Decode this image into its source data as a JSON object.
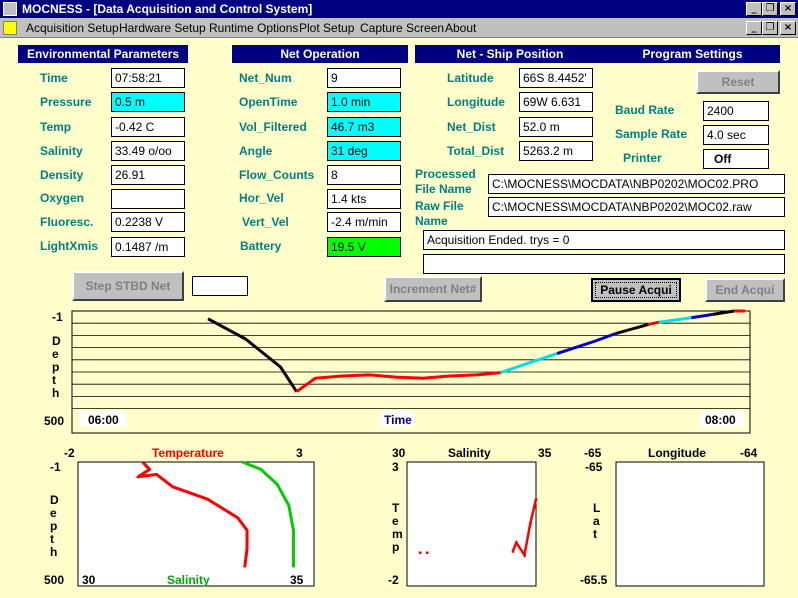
{
  "window": {
    "title": "MOCNESS - [Data Acquisition and Control System]"
  },
  "menu": [
    "Acquisition Setup",
    "Hardware Setup",
    "Runtime Options",
    "Plot Setup",
    "Capture Screen",
    "About"
  ],
  "headers": {
    "env": "Environmental Parameters",
    "net": "Net Operation",
    "pos": "Net - Ship Position",
    "prog": "Program Settings"
  },
  "env": {
    "time_label": "Time",
    "time": "07:58:21",
    "pressure_label": "Pressure",
    "pressure": "0.5 m",
    "temp_label": "Temp",
    "temp": "-0.42 C",
    "salinity_label": "Salinity",
    "salinity": "33.49 o/oo",
    "density_label": "Density",
    "density": "26.91",
    "oxygen_label": "Oxygen",
    "oxygen": "",
    "fluoresc_label": "Fluoresc.",
    "fluoresc": "0.2238 V",
    "lightxmis_label": "LightXmis",
    "lightxmis": "0.1487 /m"
  },
  "net": {
    "net_num_label": "Net_Num",
    "net_num": "9",
    "opentime_label": "OpenTime",
    "opentime": "1.0 min",
    "vol_label": "Vol_Filtered",
    "vol": "46.7 m3",
    "angle_label": "Angle",
    "angle": "31 deg",
    "flow_label": "Flow_Counts",
    "flow": "8",
    "horvel_label": "Hor_Vel",
    "horvel": "1.4 kts",
    "vertvel_label": "Vert_Vel",
    "vertvel": "-2.4 m/min",
    "battery_label": "Battery",
    "battery": "19.5 V"
  },
  "pos": {
    "lat_label": "Latitude",
    "lat": "66S 8.4452'",
    "lon_label": "Longitude",
    "lon": "69W 6.631",
    "netdist_label": "Net_Dist",
    "netdist": "52.0 m",
    "totaldist_label": "Total_Dist",
    "totaldist": "5263.2 m",
    "processed_label_1": "Processed",
    "processed_label_2": "File Name",
    "processed": "C:\\MOCNESS\\MOCDATA\\NBP0202\\MOC02.PRO",
    "raw_label_1": "Raw File",
    "raw_label_2": "Name",
    "raw": "C:\\MOCNESS\\MOCDATA\\NBP0202\\MOC02.raw",
    "status": "Acquisition Ended. trys = 0",
    "status2": ""
  },
  "prog": {
    "reset": "Reset",
    "baud_label": "Baud Rate",
    "baud": "2400",
    "sample_label": "Sample Rate",
    "sample": "4.0 sec",
    "printer_label": "Printer",
    "printer": "Off"
  },
  "buttons": {
    "step": "Step STBD Net",
    "step_field": "",
    "increment": "Increment Net#",
    "pause": "Pause Acqui",
    "end": "End Acqui"
  },
  "colors": {
    "temperature": "#ff0000",
    "salinity": "#00cc00",
    "ctext": "#008080",
    "header": "#000080"
  },
  "chart_data": [
    {
      "type": "line",
      "name": "depth-time",
      "ylabel": "Depth",
      "xlabel": "Time",
      "y_top_label": "-1",
      "y_bottom_label": "500",
      "x_left_label": "06:00",
      "x_right_label": "08:00",
      "segments": [
        {
          "color": "#000000",
          "points": [
            [
              0.0,
              0.07
            ],
            [
              0.07,
              0.25
            ],
            [
              0.135,
              0.5
            ],
            [
              0.165,
              0.72
            ]
          ]
        },
        {
          "color": "#ff0000",
          "points": [
            [
              0.165,
              0.72
            ],
            [
              0.2,
              0.6
            ],
            [
              0.25,
              0.58
            ],
            [
              0.3,
              0.57
            ],
            [
              0.35,
              0.59
            ],
            [
              0.4,
              0.6
            ],
            [
              0.45,
              0.58
            ],
            [
              0.5,
              0.57
            ],
            [
              0.545,
              0.55
            ]
          ]
        },
        {
          "color": "#00e0e0",
          "points": [
            [
              0.545,
              0.55
            ],
            [
              0.6,
              0.46
            ],
            [
              0.65,
              0.38
            ]
          ]
        },
        {
          "color": "#0000cc",
          "points": [
            [
              0.65,
              0.38
            ],
            [
              0.72,
              0.27
            ],
            [
              0.76,
              0.2
            ]
          ]
        },
        {
          "color": "#000000",
          "points": [
            [
              0.76,
              0.2
            ],
            [
              0.82,
              0.12
            ]
          ]
        },
        {
          "color": "#ff0000",
          "points": [
            [
              0.82,
              0.12
            ],
            [
              0.84,
              0.1
            ]
          ]
        },
        {
          "color": "#00e0e0",
          "points": [
            [
              0.84,
              0.1
            ],
            [
              0.9,
              0.06
            ]
          ]
        },
        {
          "color": "#0000cc",
          "points": [
            [
              0.9,
              0.06
            ],
            [
              0.94,
              0.03
            ]
          ]
        },
        {
          "color": "#000000",
          "points": [
            [
              0.94,
              0.03
            ],
            [
              0.98,
              0.0
            ]
          ]
        },
        {
          "color": "#ff0000",
          "points": [
            [
              0.98,
              0.0
            ],
            [
              1.0,
              0.0
            ]
          ]
        }
      ]
    },
    {
      "type": "line",
      "name": "temp-sal-depth",
      "top_title": "Temperature",
      "top_min": "-2",
      "top_max": "3",
      "bottom_title": "Salinity",
      "bottom_min": "30",
      "bottom_max": "35",
      "ylabel": "Depth",
      "y_top": "-1",
      "y_bottom": "500",
      "series": [
        {
          "name": "Temperature",
          "color": "#ff0000",
          "points": [
            [
              0.27,
              0.0
            ],
            [
              0.3,
              0.06
            ],
            [
              0.25,
              0.12
            ],
            [
              0.33,
              0.1
            ],
            [
              0.4,
              0.2
            ],
            [
              0.55,
              0.3
            ],
            [
              0.68,
              0.45
            ],
            [
              0.72,
              0.55
            ],
            [
              0.72,
              0.7
            ],
            [
              0.71,
              0.85
            ]
          ]
        },
        {
          "name": "Salinity",
          "color": "#00cc00",
          "points": [
            [
              0.7,
              0.0
            ],
            [
              0.78,
              0.06
            ],
            [
              0.85,
              0.18
            ],
            [
              0.9,
              0.35
            ],
            [
              0.92,
              0.55
            ],
            [
              0.92,
              0.85
            ]
          ]
        }
      ]
    },
    {
      "type": "scatter",
      "name": "temp-salinity",
      "title": "Salinity",
      "x_min": "30",
      "x_max": "35",
      "ylabel": "Temp",
      "y_top": "3",
      "y_bottom": "-2",
      "series": [
        {
          "color": "#ff0000",
          "points": [
            [
              0.0,
              0.73
            ],
            [
              0.06,
              0.73
            ],
            [
              0.8,
              0.72
            ],
            [
              0.83,
              0.65
            ],
            [
              0.9,
              0.75
            ],
            [
              0.95,
              0.5
            ],
            [
              1.0,
              0.3
            ]
          ]
        }
      ]
    },
    {
      "type": "scatter",
      "name": "lat-lon",
      "title": "Longitude",
      "x_min": "-65",
      "x_max": "-64",
      "ylabel": "Lat",
      "y_top": "-65",
      "y_bottom": "-65.5",
      "series": []
    }
  ]
}
